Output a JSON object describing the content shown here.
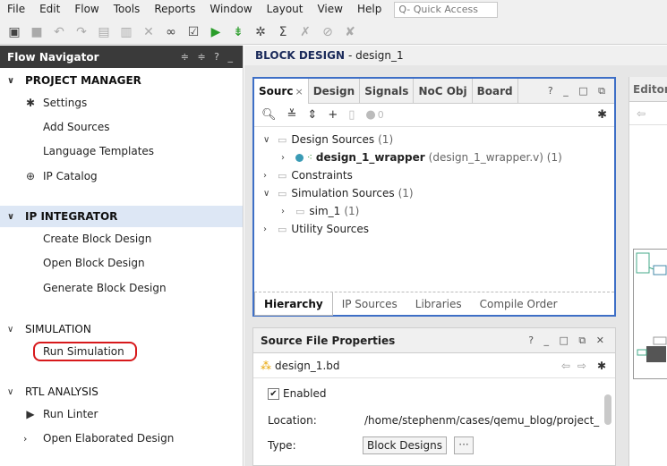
{
  "menubar": {
    "items": [
      "File",
      "Edit",
      "Flow",
      "Tools",
      "Reports",
      "Window",
      "Layout",
      "View",
      "Help"
    ],
    "quick_access_placeholder": "Q- Quick Access"
  },
  "flow_navigator": {
    "title": "Flow Navigator",
    "controls": "≑ ≑ ? _",
    "project_manager": {
      "title": "PROJECT MANAGER",
      "settings": "Settings",
      "add_sources": "Add Sources",
      "language_templates": "Language Templates",
      "ip_catalog": "IP Catalog"
    },
    "ip_integrator": {
      "title": "IP INTEGRATOR",
      "create_block_design": "Create Block Design",
      "open_block_design": "Open Block Design",
      "generate_block_design": "Generate Block Design"
    },
    "simulation": {
      "title": "SIMULATION",
      "run_simulation": "Run Simulation"
    },
    "rtl_analysis": {
      "title": "RTL ANALYSIS",
      "run_linter": "Run Linter",
      "open_elaborated_design": "Open Elaborated Design"
    }
  },
  "block_design": {
    "title": "BLOCK DESIGN",
    "design_name": "- design_1"
  },
  "sources_panel": {
    "tabs": [
      "Sourc",
      "Design",
      "Signals",
      "NoC Obj",
      "Board"
    ],
    "tab_close": "×",
    "controls": "? _ □ ⧉",
    "count_badge": "0",
    "tree": {
      "design_sources": "Design Sources",
      "design_sources_count": "(1)",
      "wrapper_name": "design_1_wrapper",
      "wrapper_file": "(design_1_wrapper.v) (1)",
      "constraints": "Constraints",
      "simulation_sources": "Simulation Sources",
      "simulation_sources_count": "(1)",
      "sim_1": "sim_1",
      "sim_1_count": "(1)",
      "utility_sources": "Utility Sources"
    },
    "bottom_tabs": [
      "Hierarchy",
      "IP Sources",
      "Libraries",
      "Compile Order"
    ]
  },
  "source_file_properties": {
    "title": "Source File Properties",
    "controls": "? _ □ ⧉ ✕",
    "file_name": "design_1.bd",
    "enabled_label": "Enabled",
    "location_label": "Location:",
    "location_value": "/home/stephenm/cases/qemu_blog/project_",
    "type_label": "Type:",
    "type_value": "Block Designs",
    "type_more": "···"
  },
  "editor": {
    "title": "Editor"
  },
  "colors": {
    "active_panel_border": "#3e6fc6",
    "nav_header_bg": "#3a3a3a",
    "highlight_box": "#d7191c",
    "run_icon": "#2a9d2a"
  }
}
